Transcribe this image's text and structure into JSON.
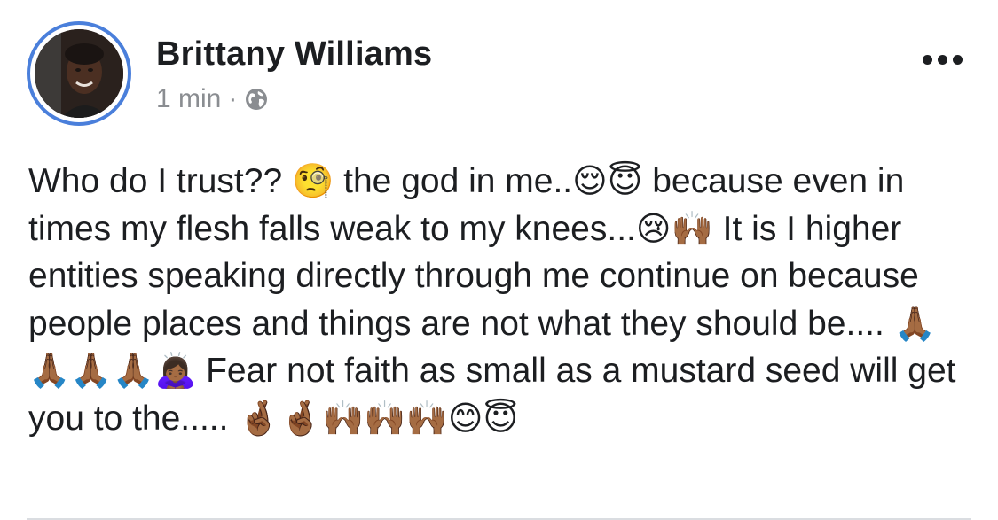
{
  "post": {
    "author_name": "Brittany Williams",
    "timestamp": "1 min",
    "separator": "·",
    "privacy_icon": "globe-icon",
    "more_icon": "more-options-icon",
    "text_segments": [
      "Who do I trust?? ",
      "🧐",
      " the god in me..",
      "😌😇",
      " because even in times my flesh falls weak to my knees...",
      "😢🙌🏾",
      " It is I higher entities speaking directly through me continue on because people places and things are not what they should be.... ",
      "🙏🏾🙏🏾🙏🏾🙏🏾🙇🏾‍♀️",
      " Fear not faith as small as a mustard seed will get you to the..... ",
      "🤞🏾🤞🏾🙌🏾🙌🏾🙌🏾😊😇"
    ]
  },
  "colors": {
    "avatar_ring": "#4a7fdb",
    "name_text": "#1c1e21",
    "meta_text": "#8a8d91",
    "divider": "#dadde1"
  }
}
